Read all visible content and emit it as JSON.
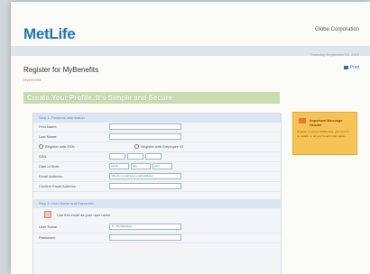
{
  "header": {
    "logo": "MetLife",
    "company": "Globe Corporation",
    "date": "Thursday, September 03, 2015"
  },
  "page": {
    "title": "Register for MyBenefits",
    "subtitle": "MyBenefits",
    "print_label": "Print",
    "banner": "Create Your Profile. It's Simple and Secure"
  },
  "form": {
    "step1": "Step 1: Personal Information",
    "first_name": "First Name:",
    "last_name": "Last Name:",
    "radio_ssn": "Register with SSN",
    "radio_emp": "Register with Employee ID",
    "ssn": "SSN:",
    "dob": "Date of Birth:",
    "dob_month": "month",
    "dob_day": "day",
    "dob_year": "year",
    "email": "Email Address:",
    "email_hint": "We do not sell your email address",
    "confirm_email": "Confirm Email Address:",
    "step2": "Step 2: User Name and Password",
    "check_text": "Use this email as your user name",
    "user_name": "User Name:",
    "user_name_hint": "6 - 20 characters",
    "password": "Password:"
  },
  "sidebar": {
    "title": "Important Message Header",
    "text": "Register to access MyBenefits, your source for details on all your benefit information."
  }
}
